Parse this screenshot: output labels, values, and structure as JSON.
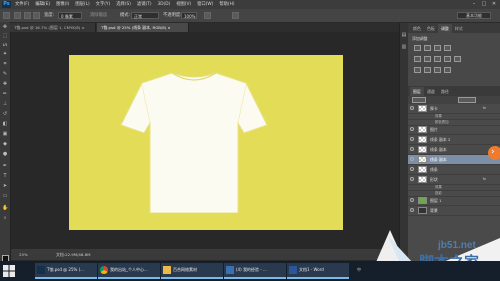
{
  "app": {
    "logo": "Ps",
    "menu": [
      "文件(F)",
      "编辑(E)",
      "图像(I)",
      "图层(L)",
      "文字(Y)",
      "选择(S)",
      "滤镜(T)",
      "3D(D)",
      "视图(V)",
      "窗口(W)",
      "帮助(H)"
    ],
    "window_controls": [
      "–",
      "□",
      "✕"
    ]
  },
  "options": {
    "width_label": "宽度:",
    "width_value": "0 像素",
    "mode_label": "模式:",
    "mode_value": "正常",
    "opacity_label": "不透明度:",
    "opacity_value": "100%",
    "antialias_label": "消除锯齿",
    "workspace": "基本功能"
  },
  "tabs": [
    {
      "label": "T恤.psd @ 16.7% (图层 1, CMYK/8) ×",
      "active": false
    },
    {
      "label": "T恤.psd @ 25% (线条 副本, RGB/8) ×",
      "active": true
    }
  ],
  "status": {
    "zoom": "25%",
    "doc": "文档:22.9M/46.8M"
  },
  "right_panel": {
    "adjust_tabs": [
      "颜色",
      "色板",
      "调整",
      "样式"
    ],
    "adjust_title": "添加调整",
    "layer_tabs": [
      "图层",
      "通道",
      "路径"
    ],
    "layers": [
      {
        "name": "厚卡",
        "type": "layer",
        "selected": false,
        "fx": true
      },
      {
        "name": "效果",
        "type": "sub",
        "selected": false
      },
      {
        "name": "颜色叠加",
        "type": "sub",
        "selected": false
      },
      {
        "name": "图片",
        "type": "layer",
        "selected": false,
        "fx": false
      },
      {
        "name": "线条 副本 2",
        "type": "layer",
        "selected": false,
        "fx": false
      },
      {
        "name": "线条 副本",
        "type": "layer",
        "selected": false,
        "fx": false
      },
      {
        "name": "线条 副本",
        "type": "layer",
        "selected": true,
        "fx": false
      },
      {
        "name": "线条",
        "type": "layer",
        "selected": false,
        "fx": false
      },
      {
        "name": "形状",
        "type": "layer",
        "selected": false,
        "fx": true
      },
      {
        "name": "效果",
        "type": "sub",
        "selected": false
      },
      {
        "name": "投影",
        "type": "sub",
        "selected": false
      },
      {
        "name": "图层 1",
        "type": "layer",
        "selected": false,
        "fx": false
      },
      {
        "name": "背景",
        "type": "layer",
        "selected": false,
        "fx": false
      }
    ]
  },
  "watermark": {
    "site": "jb51.net",
    "text": "脚本之家"
  },
  "taskbar": {
    "items": [
      {
        "title": "T恤.psd @ 25% (..."
      },
      {
        "title": "我的出站_个人中心..."
      },
      {
        "title": "百合网络素材"
      },
      {
        "title": "(4) 我的经验 - ..."
      },
      {
        "title": "文档1 - Word"
      }
    ],
    "tray_time": "",
    "tray_lang": "中"
  },
  "colors": {
    "canvas": "#e2dc56",
    "selected_layer": "#7b8fa8",
    "accent_orange": "#f07a2e"
  }
}
